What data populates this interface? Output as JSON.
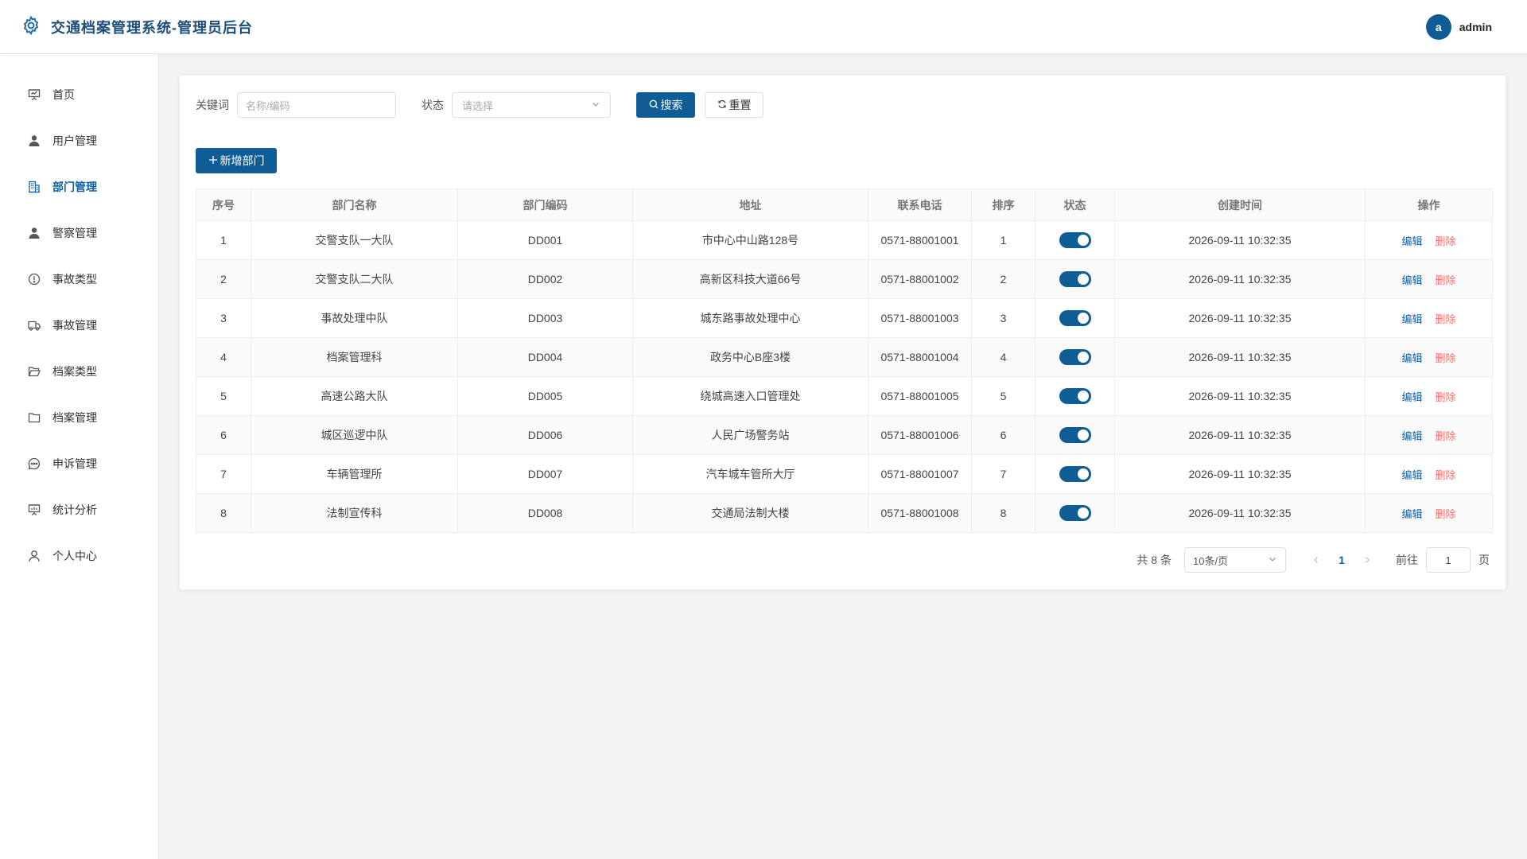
{
  "header": {
    "title": "交通档案管理系统-管理员后台",
    "avatar_letter": "a",
    "username": "admin"
  },
  "sidebar": {
    "items": [
      {
        "label": "首页",
        "icon": "presentation-board-icon",
        "active": false
      },
      {
        "label": "用户管理",
        "icon": "user-filled-icon",
        "active": false
      },
      {
        "label": "部门管理",
        "icon": "office-building-icon",
        "active": true
      },
      {
        "label": "警察管理",
        "icon": "user-filled-icon",
        "active": false
      },
      {
        "label": "事故类型",
        "icon": "warning-circle-icon",
        "active": false
      },
      {
        "label": "事故管理",
        "icon": "truck-icon",
        "active": false
      },
      {
        "label": "档案类型",
        "icon": "folder-opened-icon",
        "active": false
      },
      {
        "label": "档案管理",
        "icon": "folder-icon",
        "active": false
      },
      {
        "label": "申诉管理",
        "icon": "chat-dots-icon",
        "active": false
      },
      {
        "label": "统计分析",
        "icon": "data-board-icon",
        "active": false
      },
      {
        "label": "个人中心",
        "icon": "user-outline-icon",
        "active": false
      }
    ]
  },
  "filters": {
    "keyword_label": "关键词",
    "keyword_placeholder": "名称/编码",
    "status_label": "状态",
    "status_placeholder": "请选择",
    "search_label": "搜索",
    "reset_label": "重置"
  },
  "toolbar": {
    "add_label": "新增部门"
  },
  "table": {
    "columns": [
      "序号",
      "部门名称",
      "部门编码",
      "地址",
      "联系电话",
      "排序",
      "状态",
      "创建时间",
      "操作"
    ],
    "rows": [
      {
        "index": "1",
        "name": "交警支队一大队",
        "code": "DD001",
        "address": "市中心中山路128号",
        "phone": "0571-88001001",
        "sort": "1",
        "enabled": true,
        "created": "2026-09-11 10:32:35"
      },
      {
        "index": "2",
        "name": "交警支队二大队",
        "code": "DD002",
        "address": "高新区科技大道66号",
        "phone": "0571-88001002",
        "sort": "2",
        "enabled": true,
        "created": "2026-09-11 10:32:35"
      },
      {
        "index": "3",
        "name": "事故处理中队",
        "code": "DD003",
        "address": "城东路事故处理中心",
        "phone": "0571-88001003",
        "sort": "3",
        "enabled": true,
        "created": "2026-09-11 10:32:35"
      },
      {
        "index": "4",
        "name": "档案管理科",
        "code": "DD004",
        "address": "政务中心B座3楼",
        "phone": "0571-88001004",
        "sort": "4",
        "enabled": true,
        "created": "2026-09-11 10:32:35"
      },
      {
        "index": "5",
        "name": "高速公路大队",
        "code": "DD005",
        "address": "绕城高速入口管理处",
        "phone": "0571-88001005",
        "sort": "5",
        "enabled": true,
        "created": "2026-09-11 10:32:35"
      },
      {
        "index": "6",
        "name": "城区巡逻中队",
        "code": "DD006",
        "address": "人民广场警务站",
        "phone": "0571-88001006",
        "sort": "6",
        "enabled": true,
        "created": "2026-09-11 10:32:35"
      },
      {
        "index": "7",
        "name": "车辆管理所",
        "code": "DD007",
        "address": "汽车城车管所大厅",
        "phone": "0571-88001007",
        "sort": "7",
        "enabled": true,
        "created": "2026-09-11 10:32:35"
      },
      {
        "index": "8",
        "name": "法制宣传科",
        "code": "DD008",
        "address": "交通局法制大楼",
        "phone": "0571-88001008",
        "sort": "8",
        "enabled": true,
        "created": "2026-09-11 10:32:35"
      }
    ],
    "edit_label": "编辑",
    "delete_label": "删除"
  },
  "pagination": {
    "total_text": "共 8 条",
    "page_size": "10条/页",
    "current_page": "1",
    "goto_label": "前往",
    "goto_value": "1",
    "page_suffix": "页"
  },
  "colors": {
    "primary": "#0f5d94",
    "link": "#1060a8",
    "danger": "#f56c6c"
  }
}
